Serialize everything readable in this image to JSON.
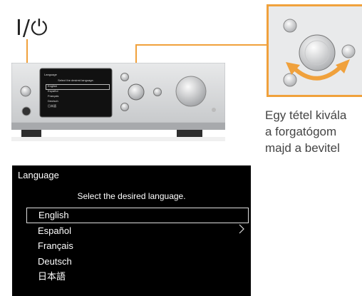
{
  "power_symbol": "I/⏻",
  "device_screen": {
    "title": "Language",
    "prompt": "Select the desired language.",
    "items": [
      "English",
      "Español",
      "Français",
      "Deutsch",
      "日本語"
    ]
  },
  "caption_lines": [
    "Egy tétel kivála",
    "a forgatógom",
    "majd a bevitel"
  ],
  "language_screen": {
    "title": "Language",
    "prompt": "Select the desired language.",
    "items": [
      {
        "label": "English",
        "selected": true
      },
      {
        "label": "Español",
        "selected": false
      },
      {
        "label": "Français",
        "selected": false
      },
      {
        "label": "Deutsch",
        "selected": false
      },
      {
        "label": "日本語",
        "selected": false
      }
    ]
  },
  "colors": {
    "callout": "#f0a13c",
    "screen_bg": "#000000",
    "caption_text": "#444444",
    "device_silver": "#d5d7d9",
    "rotation_arrow": "#f0a13c"
  },
  "icons": [
    "power-icon",
    "knob-icon",
    "rotate-arrow-icon",
    "chevron-right-icon"
  ]
}
